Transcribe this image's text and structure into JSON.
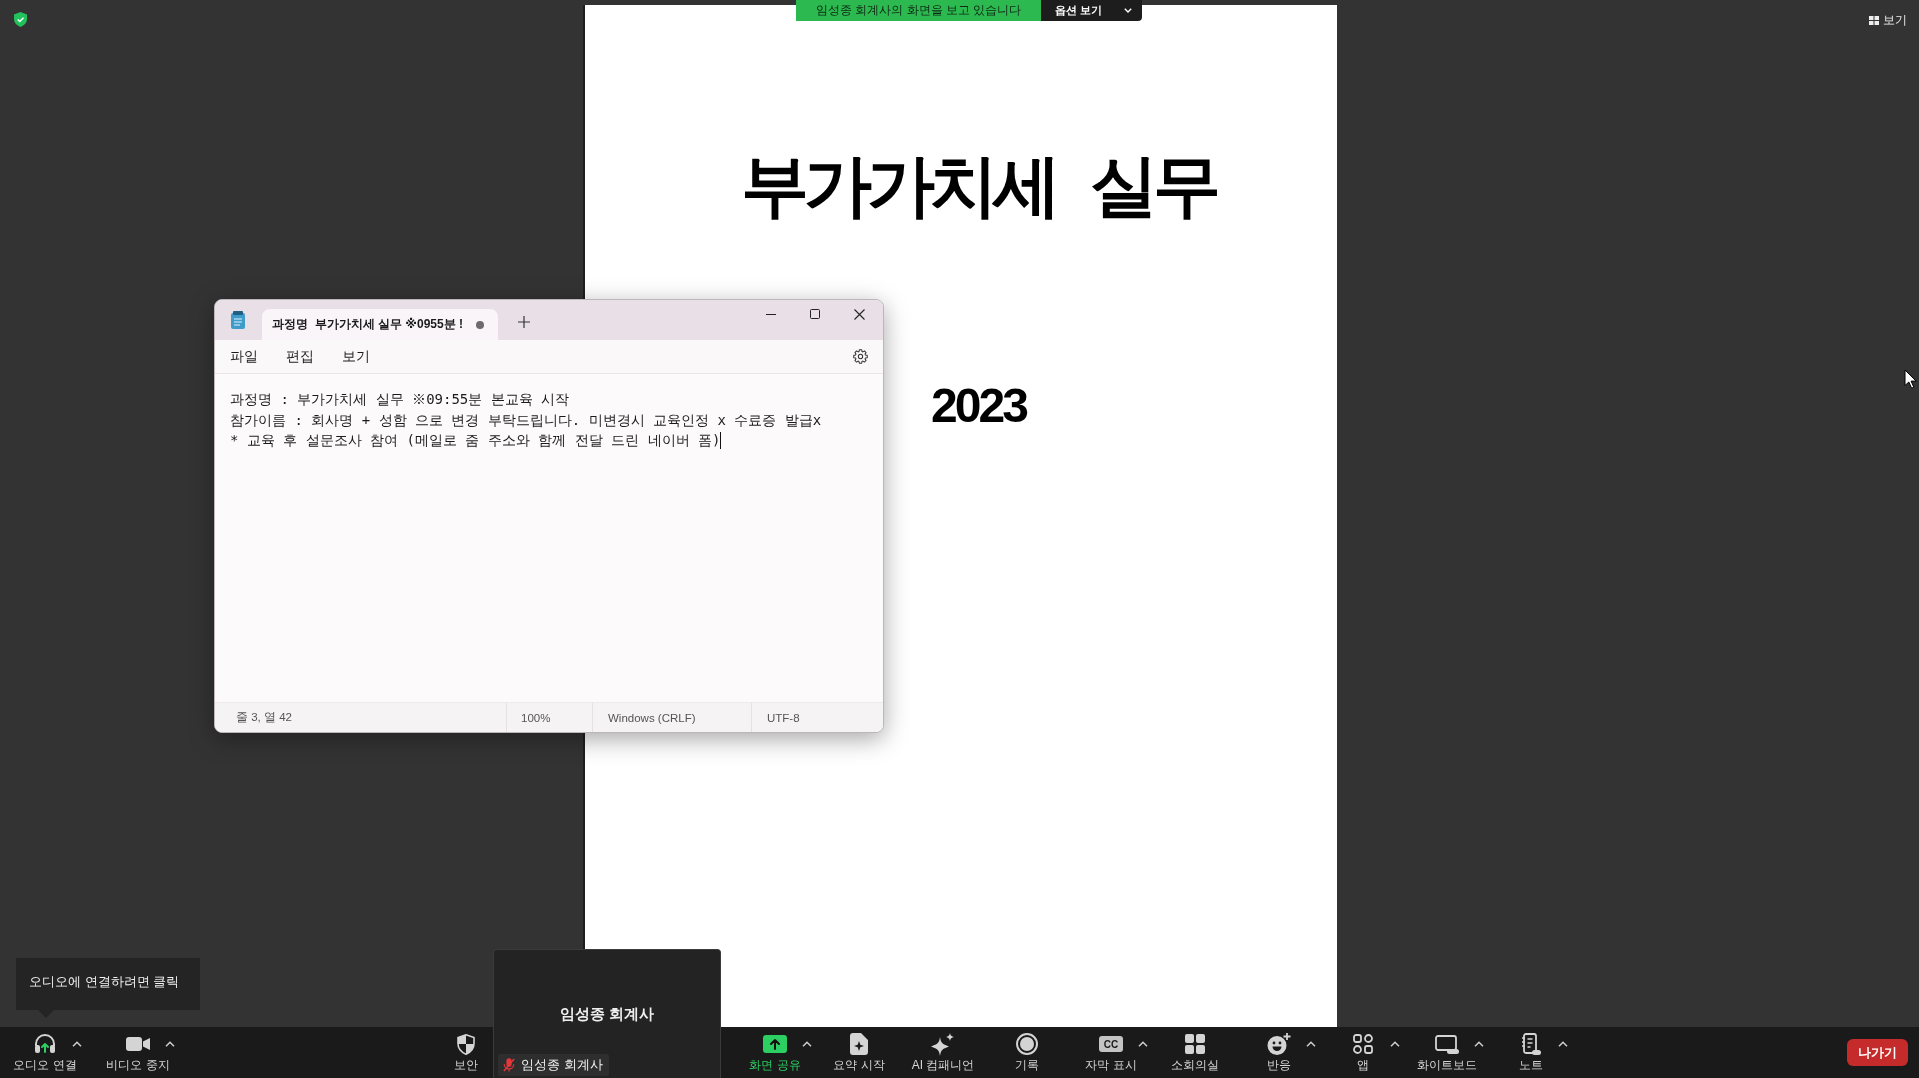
{
  "screen_share": {
    "banner": "임성종 회계사의 화면을 보고 있습니다",
    "options_button": "옵션 보기"
  },
  "view_button": "보기",
  "slide": {
    "title": "부가가치세 실무",
    "subtitle": "2023"
  },
  "notepad": {
    "tabs": [
      {
        "title": "과정명  부가가치세 실무 ※0955분 !",
        "selected": true,
        "unsaved": true
      }
    ],
    "menu": [
      "파일",
      "편집",
      "보기"
    ],
    "lines": [
      "과정명 : 부가가치세 실무 ※09:55분 본교육 시작",
      "참가이름 : 회사명 + 성함 으로 변경 부탁드립니다. 미변경시 교육인정 x 수료증 발급x",
      "* 교육 후 설문조사 참여 (메일로 줌 주소와 함께 전달 드린 네이버 폼)"
    ],
    "text_cursor": true,
    "status_bar": {
      "position": "줄 3, 열 42",
      "zoom": "100%",
      "line_ending": "Windows (CRLF)",
      "encoding": "UTF-8"
    }
  },
  "audio_tooltip": "오디오에 연결하려면 클릭",
  "video_tile": {
    "name": "임성종 회계사",
    "label": "임성종 회계사",
    "muted": true
  },
  "toolbar": {
    "left": [
      {
        "kind": "audio",
        "label": "오디오 연결",
        "menu": true
      },
      {
        "kind": "video",
        "label": "비디오 중지",
        "menu": true
      }
    ],
    "center": [
      {
        "kind": "security",
        "label": "보안",
        "menu": false
      },
      {
        "kind": "share",
        "label": "화면 공유",
        "menu": true
      },
      {
        "kind": "summary",
        "label": "요약 시작",
        "menu": false
      },
      {
        "kind": "companion",
        "label": "AI 컴패니언",
        "menu": false
      },
      {
        "kind": "record",
        "label": "기록",
        "menu": false
      },
      {
        "kind": "captions",
        "label": "자막 표시",
        "icon_text": "CC",
        "menu": true
      },
      {
        "kind": "breakout",
        "label": "소회의실",
        "menu": false
      },
      {
        "kind": "reactions",
        "label": "반응",
        "menu": true
      },
      {
        "kind": "apps",
        "label": "앱",
        "menu": true
      },
      {
        "kind": "whiteboard",
        "label": "화이트보드",
        "menu": true
      },
      {
        "kind": "notes",
        "label": "노트",
        "menu": true
      }
    ],
    "leave_button": "나가기"
  }
}
